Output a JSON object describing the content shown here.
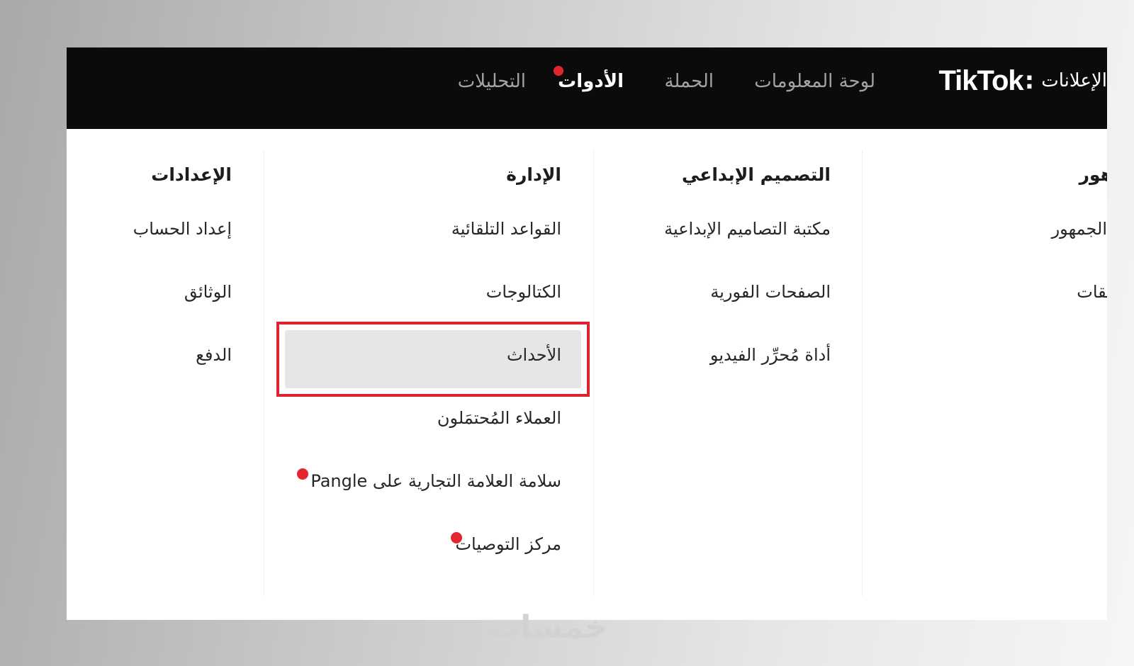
{
  "colors": {
    "accent": "#e5252e",
    "topbar": "#0b0b0b",
    "highlight": "#e0212e"
  },
  "header": {
    "brand_logo": "TikTok",
    "brand_colon": ":",
    "brand_ads": "الإعلانات",
    "nav": [
      {
        "label": "لوحة المعلومات",
        "active": false
      },
      {
        "label": "الحملة",
        "active": false
      },
      {
        "label": "الأدوات",
        "active": true,
        "badge": true
      },
      {
        "label": "التحليلات",
        "active": false
      }
    ]
  },
  "menu": {
    "audience": {
      "title": "هور",
      "items": [
        "الجمهور",
        "يقات"
      ]
    },
    "creative": {
      "title": "التصميم الإبداعي",
      "items": [
        "مكتبة التصاميم الإبداعية",
        "الصفحات الفورية",
        "أداة مُحرِّر الفيديو"
      ]
    },
    "management": {
      "title": "الإدارة",
      "items": [
        "القواعد التلقائية",
        "الكتالوجات",
        "الأحداث",
        "العملاء المُحتمَلون",
        "سلامة العلامة التجارية على Pangle",
        "مركز التوصيات"
      ]
    },
    "settings": {
      "title": "الإعدادات",
      "items": [
        "إعداد الحساب",
        "الوثائق",
        "الدفع"
      ]
    }
  },
  "watermark": "خمسات"
}
